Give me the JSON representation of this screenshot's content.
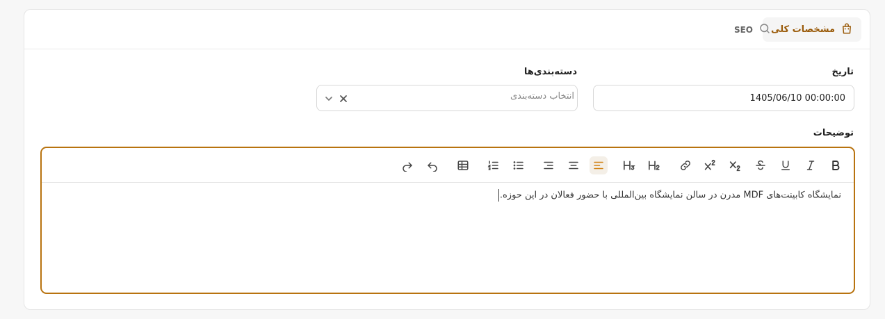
{
  "tabs": {
    "general": "مشخصات کلی",
    "seo": "SEO"
  },
  "form": {
    "date_label": "تاریخ",
    "date_value": "1405/06/10 00:00:00",
    "categories_label": "دسته‌بندی‌ها",
    "categories_placeholder": "انتخاب دسته‌بندی",
    "description_label": "توضیحات",
    "description_text": "نمایشگاه کابینت‌های MDF مدرن در سالن نمایشگاه بین‌المللی با حضور فعالان در این حوزه."
  },
  "toolbar": {
    "items": [
      "bold-icon",
      "italic-icon",
      "underline-icon",
      "strikethrough-icon",
      "subscript-icon",
      "superscript-icon",
      "link-icon",
      "heading2-icon",
      "heading3-icon",
      "align-right-icon",
      "align-center-icon",
      "align-left-icon",
      "bullet-list-icon",
      "ordered-list-icon",
      "table-icon",
      "undo-icon",
      "redo-icon"
    ],
    "active": "align-right-icon"
  },
  "colors": {
    "accent": "#b8730f",
    "accent_text": "#9a5b0a",
    "active_icon": "#d08010"
  }
}
